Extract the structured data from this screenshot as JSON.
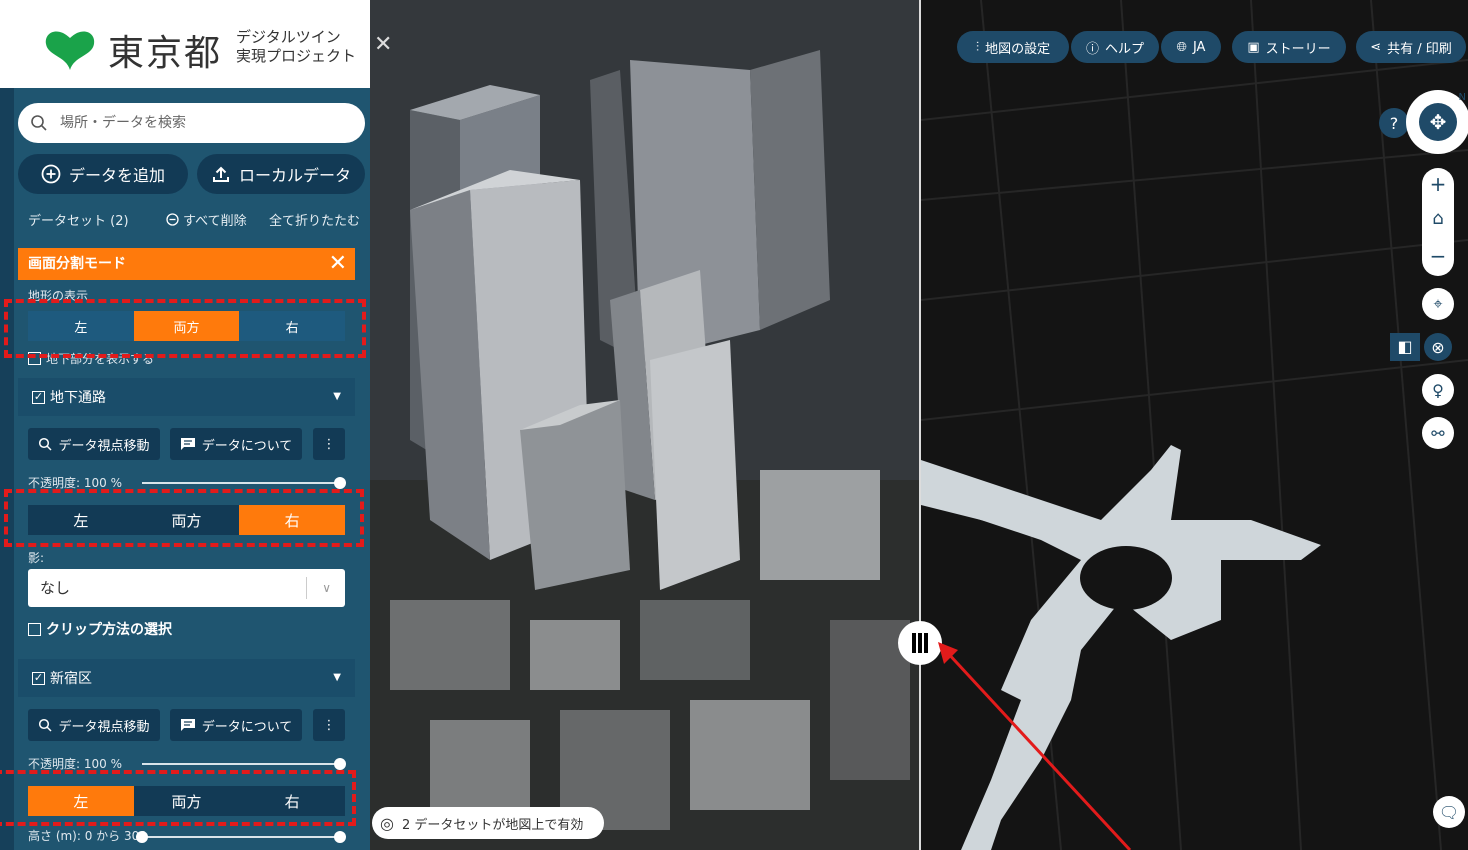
{
  "logo": {
    "title": "東京都",
    "subtitle_line1": "デジタルツイン",
    "subtitle_line2": "実現プロジェクト"
  },
  "search": {
    "placeholder": "場所・データを検索"
  },
  "buttons": {
    "add_data": "データを追加",
    "local_data": "ローカルデータ"
  },
  "datasets": {
    "count_label": "データセット (2)",
    "remove_all": "すべて削除",
    "collapse_all": "全て折りたたむ"
  },
  "split_mode": {
    "title": "画面分割モード",
    "terrain_label": "地形の表示",
    "terrain_options": [
      "左",
      "両方",
      "右"
    ],
    "terrain_selected": "両方",
    "underground_checkbox": "地下部分を表示する"
  },
  "layers": [
    {
      "name": "地下通路",
      "checked": true,
      "view_button": "データ視点移動",
      "about_button": "データについて",
      "opacity_label": "不透明度: 100 %",
      "opacity": 1.0,
      "split_options": [
        "左",
        "両方",
        "右"
      ],
      "split_selected": "右",
      "shadow_label": "影:",
      "shadow_value": "なし",
      "clip_label": "クリップ方法の選択"
    },
    {
      "name": "新宿区",
      "checked": true,
      "view_button": "データ視点移動",
      "about_button": "データについて",
      "opacity_label": "不透明度: 100 %",
      "opacity": 1.0,
      "split_options": [
        "左",
        "両方",
        "右"
      ],
      "split_selected": "左",
      "height_label": "高さ (m): 0 から 300"
    }
  ],
  "map_toolbar": {
    "settings": "地図の設定",
    "help": "ヘルプ",
    "lang": "JA",
    "story": "ストーリー",
    "share": "共有 / 印刷"
  },
  "status": {
    "text": "2 データセットが地図上で有効"
  },
  "controls": {
    "help_glyph": "?",
    "compass_north": "N"
  },
  "colors": {
    "panel": "#1f5570",
    "accent": "#ff7a0c",
    "dark_button": "#123a55",
    "highlight": "#e21b1b"
  }
}
